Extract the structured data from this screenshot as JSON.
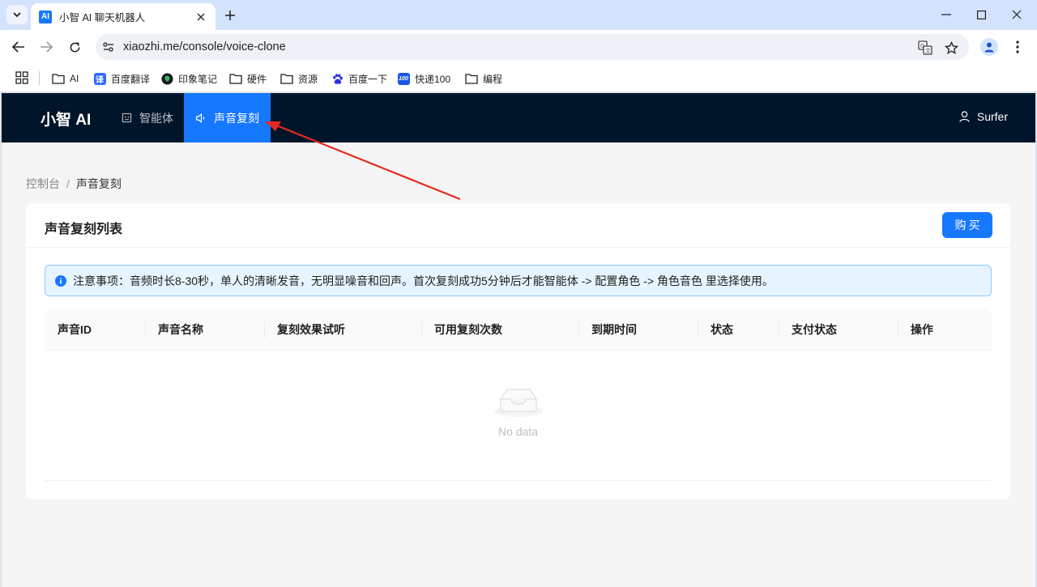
{
  "browser": {
    "tab_title": "小智 AI 聊天机器人",
    "favicon_text": "AI",
    "url": "xiaozhi.me/console/voice-clone",
    "bookmarks": [
      {
        "label": "AI",
        "icon": "folder-icon"
      },
      {
        "label": "百度翻译",
        "icon": "baidu-translate-icon",
        "badge": "译"
      },
      {
        "label": "印象笔记",
        "icon": "evernote-icon"
      },
      {
        "label": "硬件",
        "icon": "folder-icon"
      },
      {
        "label": "资源",
        "icon": "folder-icon"
      },
      {
        "label": "百度一下",
        "icon": "baidu-paw-icon"
      },
      {
        "label": "快递100",
        "icon": "kuaidi100-icon",
        "badge": "100"
      },
      {
        "label": "编程",
        "icon": "folder-icon"
      }
    ]
  },
  "app": {
    "logo": "小智 AI",
    "menu": [
      {
        "label": "智能体",
        "icon": "robot-icon",
        "active": false
      },
      {
        "label": "声音复刻",
        "icon": "sound-icon",
        "active": true
      }
    ],
    "user": "Surfer"
  },
  "breadcrumb": {
    "parent": "控制台",
    "separator": "/",
    "current": "声音复刻"
  },
  "card": {
    "title": "声音复刻列表",
    "buy_label": "购买",
    "notice": "注意事项：音频时长8-30秒，单人的清晰发音，无明显噪音和回声。首次复刻成功5分钟后才能智能体 -> 配置角色 -> 角色音色 里选择使用。"
  },
  "table": {
    "columns": [
      "声音ID",
      "声音名称",
      "复刻效果试听",
      "可用复刻次数",
      "到期时间",
      "状态",
      "支付状态",
      "操作"
    ],
    "empty_text": "No data"
  },
  "colors": {
    "primary": "#1677ff",
    "header_bg": "#001529",
    "annotation_arrow": "#e8281f"
  }
}
